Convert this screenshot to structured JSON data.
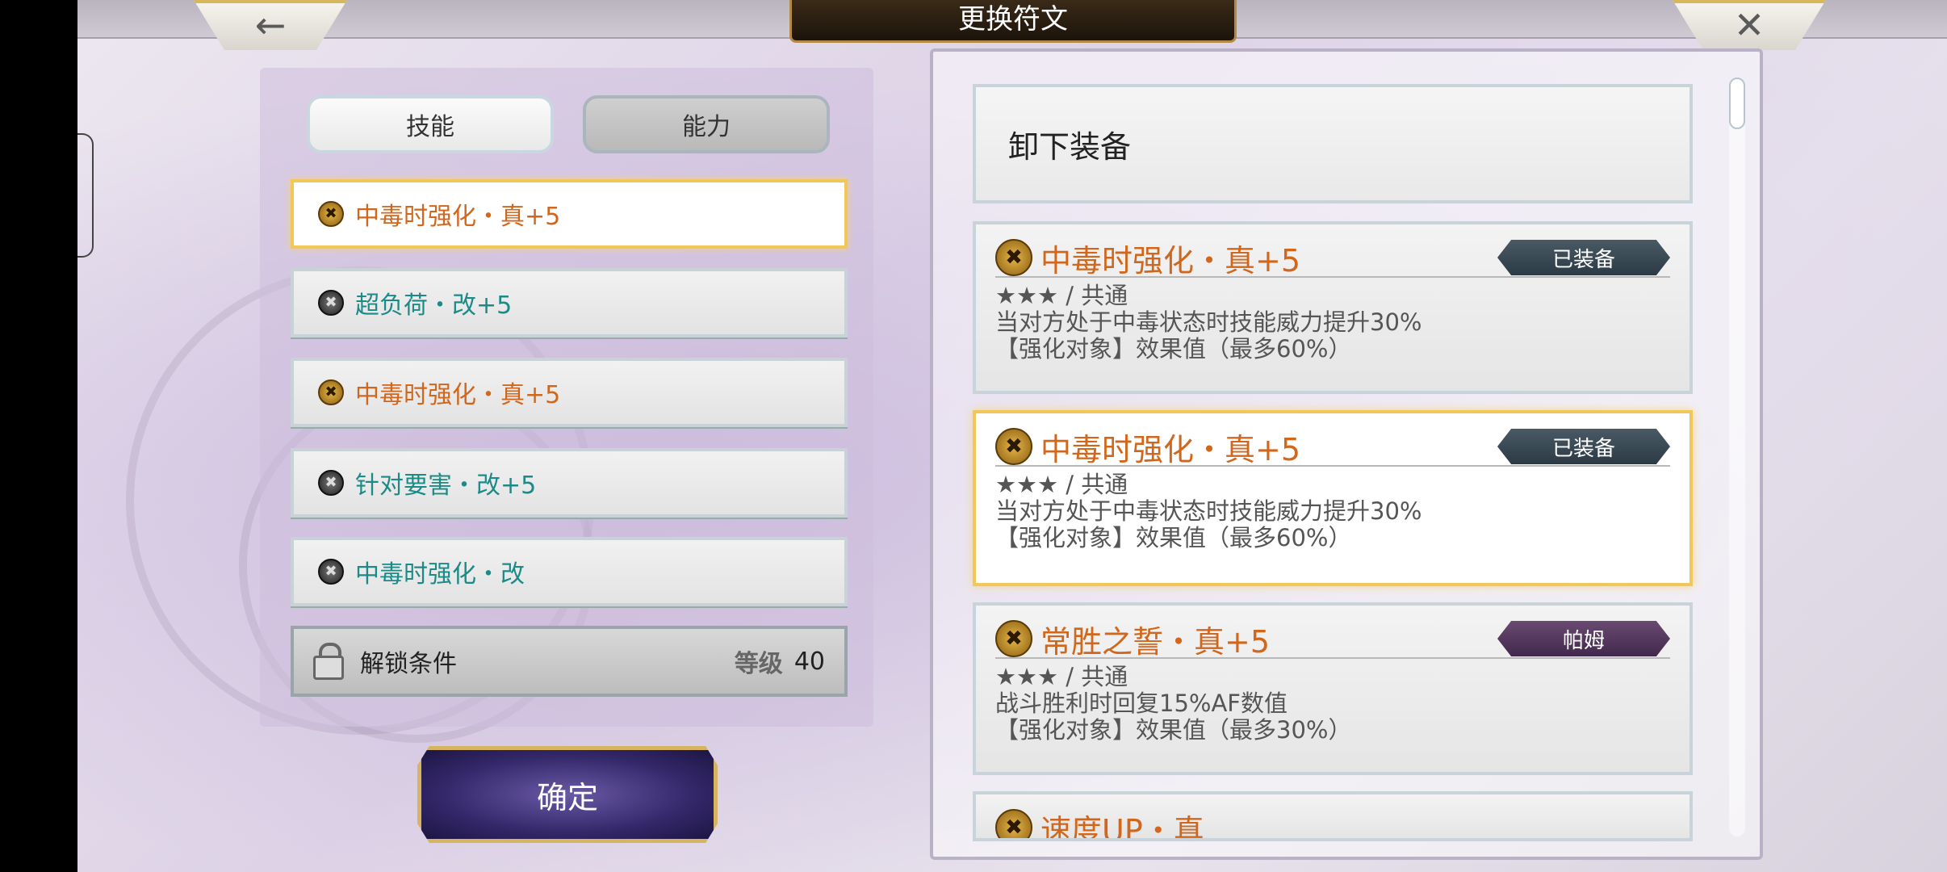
{
  "header": {
    "title": "更换符文"
  },
  "tabs": [
    {
      "label": "技能",
      "active": true
    },
    {
      "label": "能力",
      "active": false
    }
  ],
  "skill_list": [
    {
      "name": "中毒时强化・真+5",
      "rune": "gold-rune-icon",
      "color": "#d0671c",
      "selected": true
    },
    {
      "name": "超负荷・改+5",
      "rune": "dark-rune-icon",
      "color": "#1c8a86",
      "selected": false
    },
    {
      "name": "中毒时强化・真+5",
      "rune": "gold-rune-icon",
      "color": "#d0671c",
      "selected": false
    },
    {
      "name": "针对要害・改+5",
      "rune": "dark-rune-icon",
      "color": "#1c8a86",
      "selected": false
    },
    {
      "name": "中毒时强化・改",
      "rune": "dark-rune-icon",
      "color": "#1c8a86",
      "selected": false
    }
  ],
  "lock": {
    "label": "解锁条件",
    "level_label": "等级",
    "level_value": "40"
  },
  "confirm_label": "确定",
  "unequip_label": "卸下装备",
  "cards": [
    {
      "title": "中毒时强化・真+5",
      "badge": "已装备",
      "rarity": "★★★ / 共通",
      "desc": "当对方处于中毒状态时技能威力提升30%",
      "target": "【强化对象】效果值（最多60%）",
      "selected": false
    },
    {
      "title": "中毒时强化・真+5",
      "badge": "已装备",
      "rarity": "★★★ / 共通",
      "desc": "当对方处于中毒状态时技能威力提升30%",
      "target": "【强化对象】效果值（最多60%）",
      "selected": true
    },
    {
      "title": "常胜之誓・真+5",
      "badge": "帕姆",
      "rarity": "★★★ / 共通",
      "desc": "战斗胜利时回复15%AF数值",
      "target": "【强化对象】效果值（最多30%）",
      "selected": false
    },
    {
      "title": "速度UP・真",
      "selected": false
    }
  ],
  "icons": {
    "back": "back-arrow-icon",
    "close": "close-icon",
    "lock": "lock-icon"
  },
  "colors": {
    "orange_text": "#d0671c",
    "teal_text": "#1c8a86",
    "gold_border": "#f1c75a"
  }
}
